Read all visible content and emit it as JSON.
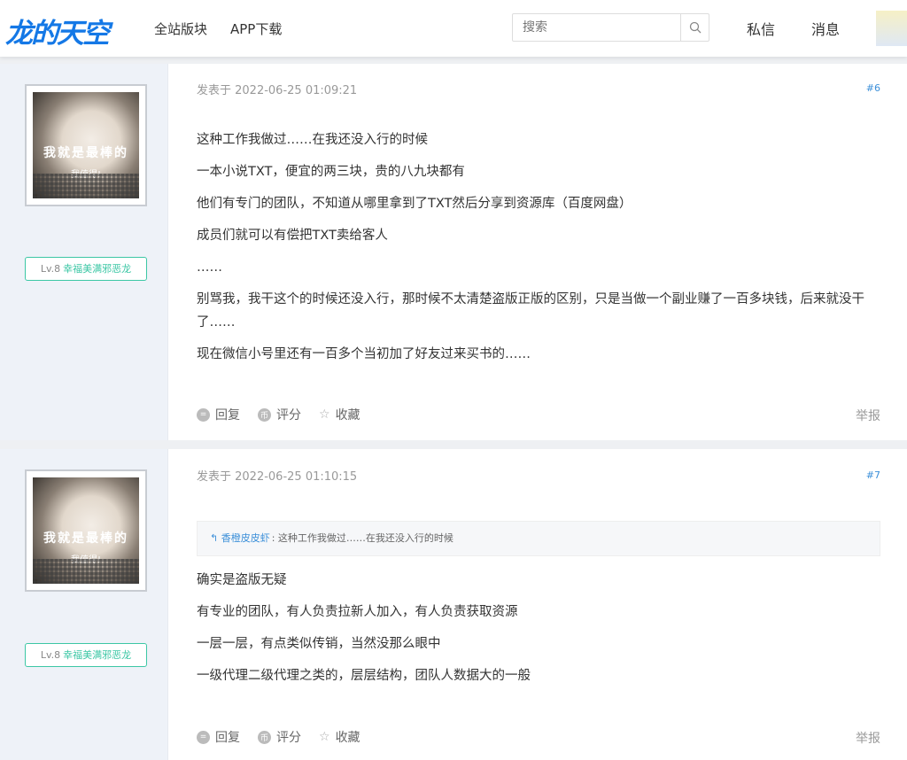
{
  "header": {
    "logo": "龙的天空",
    "nav": [
      "全站版块",
      "APP下载"
    ],
    "search_placeholder": "搜索",
    "links": [
      "私信",
      "消息"
    ]
  },
  "posts": [
    {
      "time": "发表于 2022-06-25 01:09:21",
      "floor": "#6",
      "avatar_text": [
        "我就是最棒的",
        "我值得!"
      ],
      "level": "Lv.8",
      "title": "幸福美满邪恶龙",
      "paragraphs": [
        "这种工作我做过……在我还没入行的时候",
        "一本小说TXT，便宜的两三块，贵的八九块都有",
        "他们有专门的团队，不知道从哪里拿到了TXT然后分享到资源库（百度网盘）",
        "成员们就可以有偿把TXT卖给客人",
        "……",
        "别骂我，我干这个的时候还没入行，那时候不太清楚盗版正版的区别，只是当做一个副业赚了一百多块钱，后来就没干了……",
        "现在微信小号里还有一百多个当初加了好友过来买书的……"
      ]
    },
    {
      "time": "发表于 2022-06-25 01:10:15",
      "floor": "#7",
      "avatar_text": [
        "我就是最棒的",
        "我值得!"
      ],
      "level": "Lv.8",
      "title": "幸福美满邪恶龙",
      "quote": {
        "user": "香橙皮皮虾",
        "text": "这种工作我做过……在我还没入行的时候"
      },
      "paragraphs": [
        "确实是盗版无疑",
        "有专业的团队，有人负责拉新人加入，有人负责获取资源",
        "一层一层，有点类似传销，当然没那么眼中",
        "一级代理二级代理之类的，层层结构，团队人数据大的一般"
      ]
    }
  ],
  "actions": {
    "reply": "回复",
    "rate": "评分",
    "favorite": "收藏",
    "report": "举报"
  }
}
